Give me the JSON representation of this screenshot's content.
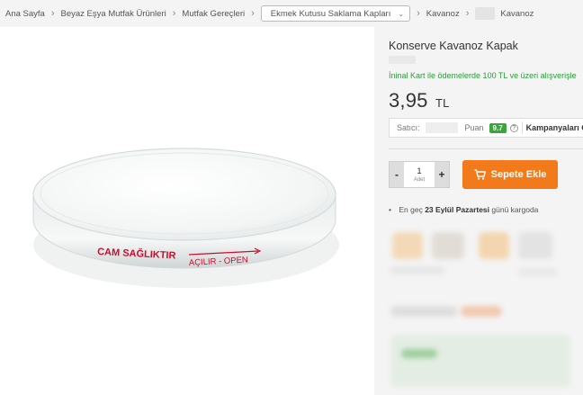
{
  "breadcrumb": {
    "items": [
      "Ana Sayfa",
      "Beyaz Eşya Mutfak Ürünleri",
      "Mutfak Gereçleri"
    ],
    "dropdown_label": "Ekmek Kutusu Saklama Kapları",
    "after": [
      "Kavanoz",
      "Kavanoz"
    ]
  },
  "product_image": {
    "lid_brand": "CAM SAĞLIKTIR",
    "lid_open": "AÇILIR - OPEN"
  },
  "product": {
    "title": "Konserve Kavanoz Kapak",
    "promo": "İninal Kart ile ödemelerde 100 TL ve üzeri alışverişle",
    "price": "3,95",
    "currency": "TL"
  },
  "seller": {
    "seller_label": "Satıcı:",
    "score_label": "Puan",
    "score": "9.7",
    "help": "?",
    "campaigns_label": "Kampanyaları G"
  },
  "purchase": {
    "minus": "-",
    "quantity": "1",
    "unit": "Adet",
    "plus": "+",
    "add_to_cart": "Sepete Ekle"
  },
  "shipping": {
    "prefix": "En geç",
    "date": "23 Eylül Pazartesi",
    "suffix": "günü kargoda"
  },
  "colors": {
    "accent": "#f27a1a",
    "promo_green": "#2e9a3e",
    "score_green": "#3aa53a"
  }
}
